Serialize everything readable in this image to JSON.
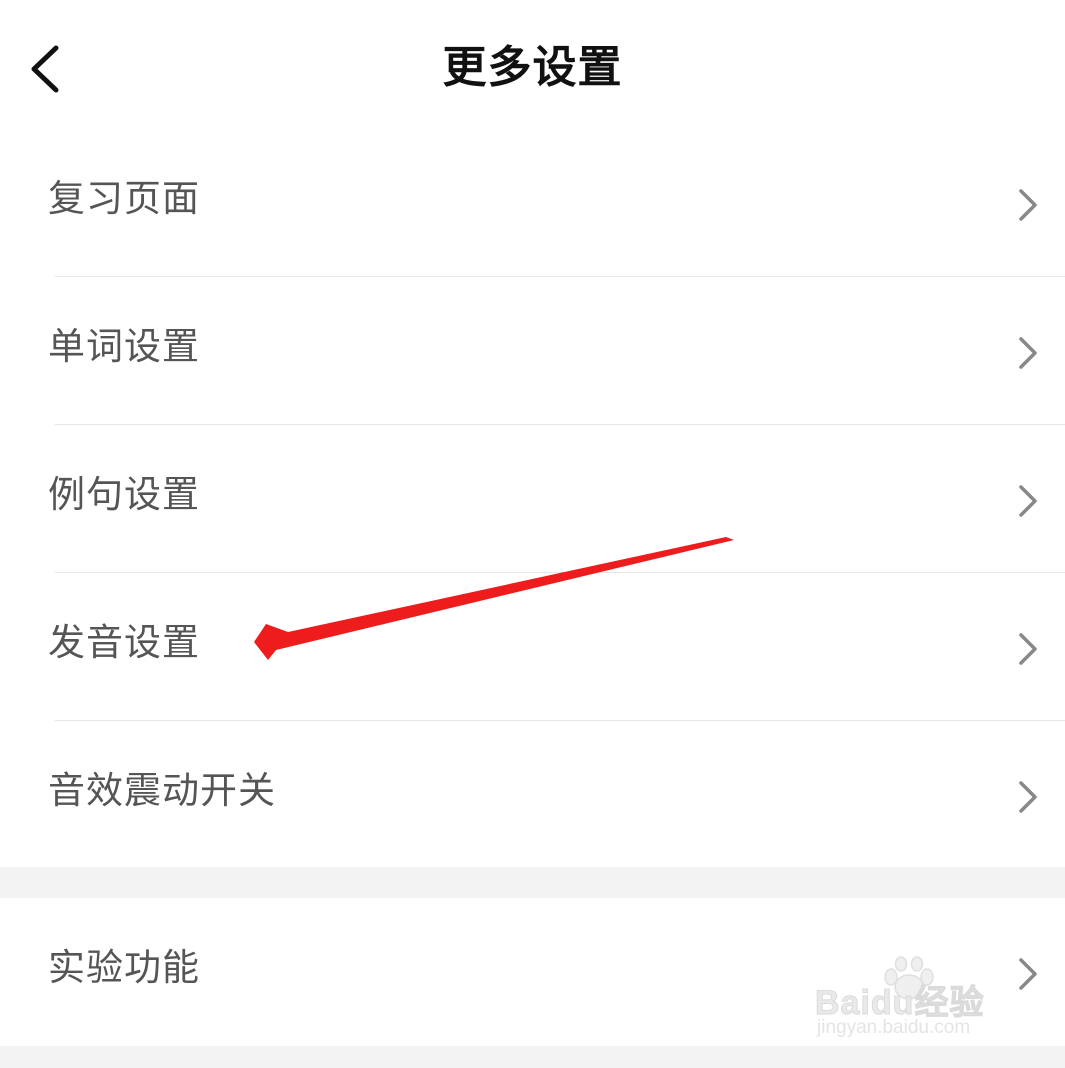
{
  "header": {
    "title": "更多设置",
    "back_icon": "chevron-left-icon"
  },
  "groups": [
    {
      "items": [
        {
          "label": "复习页面",
          "icon": "chevron-right-icon"
        },
        {
          "label": "单词设置",
          "icon": "chevron-right-icon"
        },
        {
          "label": "例句设置",
          "icon": "chevron-right-icon"
        },
        {
          "label": "发音设置",
          "icon": "chevron-right-icon"
        },
        {
          "label": "音效震动开关",
          "icon": "chevron-right-icon"
        }
      ]
    },
    {
      "items": [
        {
          "label": "实验功能",
          "icon": "chevron-right-icon"
        }
      ]
    }
  ],
  "annotation": {
    "type": "arrow",
    "color": "#ee1c1c",
    "points_to": "发音设置"
  },
  "watermark": {
    "brand": "Baidu经验",
    "url": "jingyan.baidu.com"
  },
  "colors": {
    "background": "#ffffff",
    "section_gap": "#f3f3f3",
    "divider": "#e6e6e6",
    "label_text": "#555555",
    "title_text": "#111111",
    "chevron": "#888888"
  }
}
